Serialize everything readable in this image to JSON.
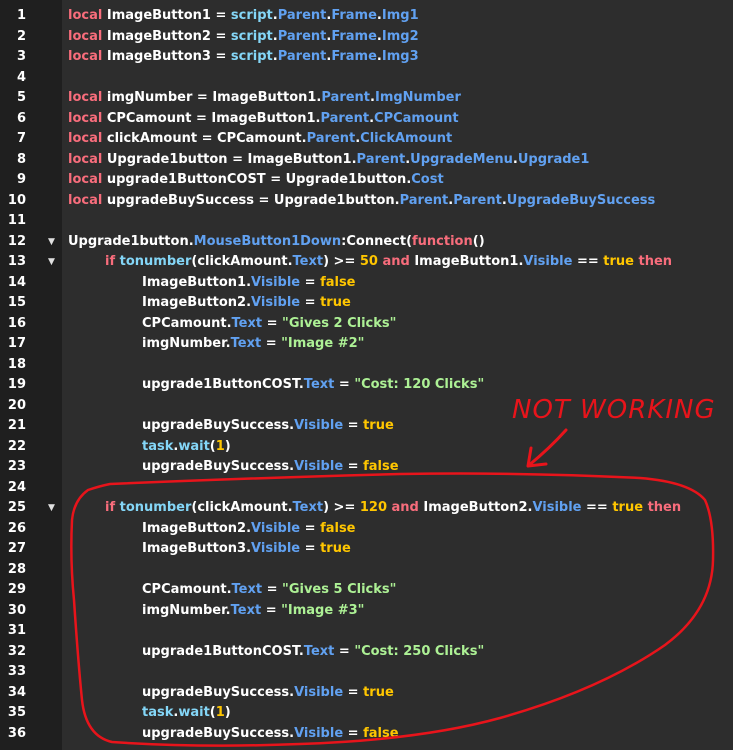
{
  "annotation": {
    "text": "NOT WORKING",
    "color": "#e8141b"
  },
  "colors": {
    "keyword": "#f86d7c",
    "builtin": "#84d6f7",
    "property": "#61a1f1",
    "number": "#ffc600",
    "bool": "#ffc600",
    "string": "#adf195",
    "identifier": "#ffffff"
  },
  "fold_lines": [
    12,
    13,
    25
  ],
  "lines": [
    {
      "n": "1",
      "indent": 0,
      "tokens": [
        [
          "kw",
          "local "
        ],
        [
          "id",
          "ImageButton1 = "
        ],
        [
          "fn",
          "script"
        ],
        [
          "op",
          "."
        ],
        [
          "prop",
          "Parent"
        ],
        [
          "op",
          "."
        ],
        [
          "prop",
          "Frame"
        ],
        [
          "op",
          "."
        ],
        [
          "prop",
          "Img1"
        ]
      ]
    },
    {
      "n": "2",
      "indent": 0,
      "tokens": [
        [
          "kw",
          "local "
        ],
        [
          "id",
          "ImageButton2 = "
        ],
        [
          "fn",
          "script"
        ],
        [
          "op",
          "."
        ],
        [
          "prop",
          "Parent"
        ],
        [
          "op",
          "."
        ],
        [
          "prop",
          "Frame"
        ],
        [
          "op",
          "."
        ],
        [
          "prop",
          "Img2"
        ]
      ]
    },
    {
      "n": "3",
      "indent": 0,
      "tokens": [
        [
          "kw",
          "local "
        ],
        [
          "id",
          "ImageButton3 = "
        ],
        [
          "fn",
          "script"
        ],
        [
          "op",
          "."
        ],
        [
          "prop",
          "Parent"
        ],
        [
          "op",
          "."
        ],
        [
          "prop",
          "Frame"
        ],
        [
          "op",
          "."
        ],
        [
          "prop",
          "Img3"
        ]
      ]
    },
    {
      "n": "4",
      "indent": 0,
      "tokens": []
    },
    {
      "n": "5",
      "indent": 0,
      "tokens": [
        [
          "kw",
          "local "
        ],
        [
          "id",
          "imgNumber = ImageButton1."
        ],
        [
          "prop",
          "Parent"
        ],
        [
          "op",
          "."
        ],
        [
          "prop",
          "ImgNumber"
        ]
      ]
    },
    {
      "n": "6",
      "indent": 0,
      "tokens": [
        [
          "kw",
          "local "
        ],
        [
          "id",
          "CPCamount = ImageButton1."
        ],
        [
          "prop",
          "Parent"
        ],
        [
          "op",
          "."
        ],
        [
          "prop",
          "CPCamount"
        ]
      ]
    },
    {
      "n": "7",
      "indent": 0,
      "tokens": [
        [
          "kw",
          "local "
        ],
        [
          "id",
          "clickAmount = CPCamount."
        ],
        [
          "prop",
          "Parent"
        ],
        [
          "op",
          "."
        ],
        [
          "prop",
          "ClickAmount"
        ]
      ]
    },
    {
      "n": "8",
      "indent": 0,
      "tokens": [
        [
          "kw",
          "local "
        ],
        [
          "id",
          "Upgrade1button = ImageButton1."
        ],
        [
          "prop",
          "Parent"
        ],
        [
          "op",
          "."
        ],
        [
          "prop",
          "UpgradeMenu"
        ],
        [
          "op",
          "."
        ],
        [
          "prop",
          "Upgrade1"
        ]
      ]
    },
    {
      "n": "9",
      "indent": 0,
      "tokens": [
        [
          "kw",
          "local "
        ],
        [
          "id",
          "upgrade1ButtonCOST = Upgrade1button."
        ],
        [
          "prop",
          "Cost"
        ]
      ]
    },
    {
      "n": "10",
      "indent": 0,
      "tokens": [
        [
          "kw",
          "local "
        ],
        [
          "id",
          "upgradeBuySuccess = Upgrade1button."
        ],
        [
          "prop",
          "Parent"
        ],
        [
          "op",
          "."
        ],
        [
          "prop",
          "Parent"
        ],
        [
          "op",
          "."
        ],
        [
          "prop",
          "UpgradeBuySuccess"
        ]
      ]
    },
    {
      "n": "11",
      "indent": 0,
      "tokens": []
    },
    {
      "n": "12",
      "indent": 0,
      "tokens": [
        [
          "id",
          "Upgrade1button."
        ],
        [
          "prop",
          "MouseButton1Down"
        ],
        [
          "op",
          ":"
        ],
        [
          "id",
          "Connect("
        ],
        [
          "kw",
          "function"
        ],
        [
          "op",
          "()"
        ]
      ]
    },
    {
      "n": "13",
      "indent": 1,
      "tokens": [
        [
          "kw",
          "if "
        ],
        [
          "fn",
          "tonumber"
        ],
        [
          "op",
          "(clickAmount."
        ],
        [
          "prop",
          "Text"
        ],
        [
          "op",
          ") >= "
        ],
        [
          "num",
          "50"
        ],
        [
          "kw",
          " and "
        ],
        [
          "id",
          "ImageButton1."
        ],
        [
          "prop",
          "Visible"
        ],
        [
          "op",
          " == "
        ],
        [
          "bool",
          "true"
        ],
        [
          "kw",
          " then"
        ]
      ]
    },
    {
      "n": "14",
      "indent": 2,
      "tokens": [
        [
          "id",
          "ImageButton1."
        ],
        [
          "prop",
          "Visible"
        ],
        [
          "op",
          " = "
        ],
        [
          "bool",
          "false"
        ]
      ]
    },
    {
      "n": "15",
      "indent": 2,
      "tokens": [
        [
          "id",
          "ImageButton2."
        ],
        [
          "prop",
          "Visible"
        ],
        [
          "op",
          " = "
        ],
        [
          "bool",
          "true"
        ]
      ]
    },
    {
      "n": "16",
      "indent": 2,
      "tokens": [
        [
          "id",
          "CPCamount."
        ],
        [
          "prop",
          "Text"
        ],
        [
          "op",
          " = "
        ],
        [
          "str",
          "\"Gives 2 Clicks\""
        ]
      ]
    },
    {
      "n": "17",
      "indent": 2,
      "tokens": [
        [
          "id",
          "imgNumber."
        ],
        [
          "prop",
          "Text"
        ],
        [
          "op",
          " = "
        ],
        [
          "str",
          "\"Image #2\""
        ]
      ]
    },
    {
      "n": "18",
      "indent": 0,
      "tokens": []
    },
    {
      "n": "19",
      "indent": 2,
      "tokens": [
        [
          "id",
          "upgrade1ButtonCOST."
        ],
        [
          "prop",
          "Text"
        ],
        [
          "op",
          " = "
        ],
        [
          "str",
          "\"Cost: 120 Clicks\""
        ]
      ]
    },
    {
      "n": "20",
      "indent": 0,
      "tokens": []
    },
    {
      "n": "21",
      "indent": 2,
      "tokens": [
        [
          "id",
          "upgradeBuySuccess."
        ],
        [
          "prop",
          "Visible"
        ],
        [
          "op",
          " = "
        ],
        [
          "bool",
          "true"
        ]
      ]
    },
    {
      "n": "22",
      "indent": 2,
      "tokens": [
        [
          "fn",
          "task"
        ],
        [
          "op",
          "."
        ],
        [
          "fn",
          "wait"
        ],
        [
          "op",
          "("
        ],
        [
          "num",
          "1"
        ],
        [
          "op",
          ")"
        ]
      ]
    },
    {
      "n": "23",
      "indent": 2,
      "tokens": [
        [
          "id",
          "upgradeBuySuccess."
        ],
        [
          "prop",
          "Visible"
        ],
        [
          "op",
          " = "
        ],
        [
          "bool",
          "false"
        ]
      ]
    },
    {
      "n": "24",
      "indent": 0,
      "tokens": []
    },
    {
      "n": "25",
      "indent": 1,
      "tokens": [
        [
          "kw",
          "if "
        ],
        [
          "fn",
          "tonumber"
        ],
        [
          "op",
          "(clickAmount."
        ],
        [
          "prop",
          "Text"
        ],
        [
          "op",
          ") >= "
        ],
        [
          "num",
          "120"
        ],
        [
          "kw",
          " and "
        ],
        [
          "id",
          "ImageButton2."
        ],
        [
          "prop",
          "Visible"
        ],
        [
          "op",
          " == "
        ],
        [
          "bool",
          "true"
        ],
        [
          "kw",
          " then"
        ]
      ]
    },
    {
      "n": "26",
      "indent": 2,
      "tokens": [
        [
          "id",
          "ImageButton2."
        ],
        [
          "prop",
          "Visible"
        ],
        [
          "op",
          " = "
        ],
        [
          "bool",
          "false"
        ]
      ]
    },
    {
      "n": "27",
      "indent": 2,
      "tokens": [
        [
          "id",
          "ImageButton3."
        ],
        [
          "prop",
          "Visible"
        ],
        [
          "op",
          " = "
        ],
        [
          "bool",
          "true"
        ]
      ]
    },
    {
      "n": "28",
      "indent": 0,
      "tokens": []
    },
    {
      "n": "29",
      "indent": 2,
      "tokens": [
        [
          "id",
          "CPCamount."
        ],
        [
          "prop",
          "Text"
        ],
        [
          "op",
          " = "
        ],
        [
          "str",
          "\"Gives 5 Clicks\""
        ]
      ]
    },
    {
      "n": "30",
      "indent": 2,
      "tokens": [
        [
          "id",
          "imgNumber."
        ],
        [
          "prop",
          "Text"
        ],
        [
          "op",
          " = "
        ],
        [
          "str",
          "\"Image #3\""
        ]
      ]
    },
    {
      "n": "31",
      "indent": 0,
      "tokens": []
    },
    {
      "n": "32",
      "indent": 2,
      "tokens": [
        [
          "id",
          "upgrade1ButtonCOST."
        ],
        [
          "prop",
          "Text"
        ],
        [
          "op",
          " = "
        ],
        [
          "str",
          "\"Cost: 250 Clicks\""
        ]
      ]
    },
    {
      "n": "33",
      "indent": 0,
      "tokens": []
    },
    {
      "n": "34",
      "indent": 2,
      "tokens": [
        [
          "id",
          "upgradeBuySuccess."
        ],
        [
          "prop",
          "Visible"
        ],
        [
          "op",
          " = "
        ],
        [
          "bool",
          "true"
        ]
      ]
    },
    {
      "n": "35",
      "indent": 2,
      "tokens": [
        [
          "fn",
          "task"
        ],
        [
          "op",
          "."
        ],
        [
          "fn",
          "wait"
        ],
        [
          "op",
          "("
        ],
        [
          "num",
          "1"
        ],
        [
          "op",
          ")"
        ]
      ]
    },
    {
      "n": "36",
      "indent": 2,
      "tokens": [
        [
          "id",
          "upgradeBuySuccess."
        ],
        [
          "prop",
          "Visible"
        ],
        [
          "op",
          " = "
        ],
        [
          "bool",
          "false"
        ]
      ]
    }
  ]
}
